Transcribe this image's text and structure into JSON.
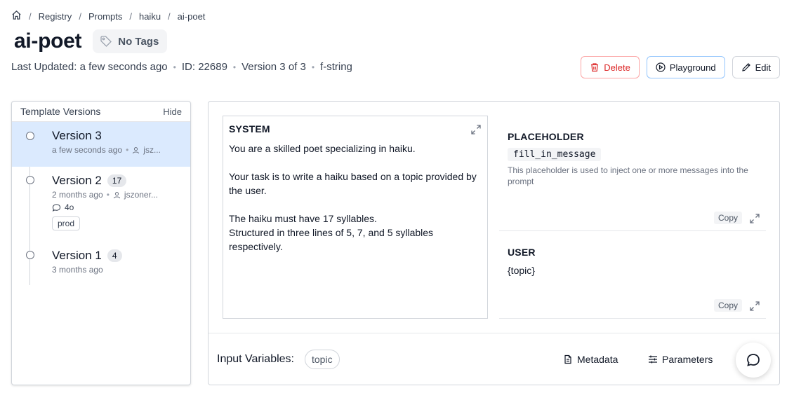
{
  "breadcrumb": {
    "home_icon": "home-icon",
    "items": [
      "Registry",
      "Prompts",
      "haiku",
      "ai-poet"
    ]
  },
  "header": {
    "title": "ai-poet",
    "tag_label": "No Tags",
    "last_updated": "Last Updated: a few seconds ago",
    "id": "ID: 22689",
    "version_info": "Version 3 of 3",
    "format": "f-string"
  },
  "actions": {
    "delete_label": "Delete",
    "playground_label": "Playground",
    "edit_label": "Edit"
  },
  "versions_panel": {
    "title": "Template Versions",
    "hide_label": "Hide",
    "items": [
      {
        "label": "Version 3",
        "count": "",
        "time": "a few seconds ago",
        "user": "jsz...",
        "comment": "",
        "release_label": ""
      },
      {
        "label": "Version 2",
        "count": "17",
        "time": "2 months ago",
        "user": "jszoner...",
        "comment": "4o",
        "release_label": "prod"
      },
      {
        "label": "Version 1",
        "count": "4",
        "time": "3 months ago",
        "user": "",
        "comment": "",
        "release_label": ""
      }
    ]
  },
  "template": {
    "system": {
      "title": "SYSTEM",
      "text": "You are a skilled poet specializing in haiku.\n\nYour task is to write a haiku based on a topic provided by the user.\n\nThe haiku must have 17 syllables.\nStructured in three lines of 5, 7, and 5 syllables respectively."
    },
    "placeholder": {
      "title": "PLACEHOLDER",
      "name": "fill_in_message",
      "description": "This placeholder is used to inject one or more messages into the prompt",
      "copy_label": "Copy"
    },
    "user": {
      "title": "USER",
      "text": "{topic}",
      "copy_label": "Copy"
    }
  },
  "bottom": {
    "input_variables_label": "Input Variables:",
    "variables": [
      "topic"
    ],
    "metadata_label": "Metadata",
    "parameters_label": "Parameters"
  },
  "colors": {
    "delete": "#dc2626",
    "active_version_bg": "#dbeafe",
    "playground_border": "#93c5fd"
  }
}
